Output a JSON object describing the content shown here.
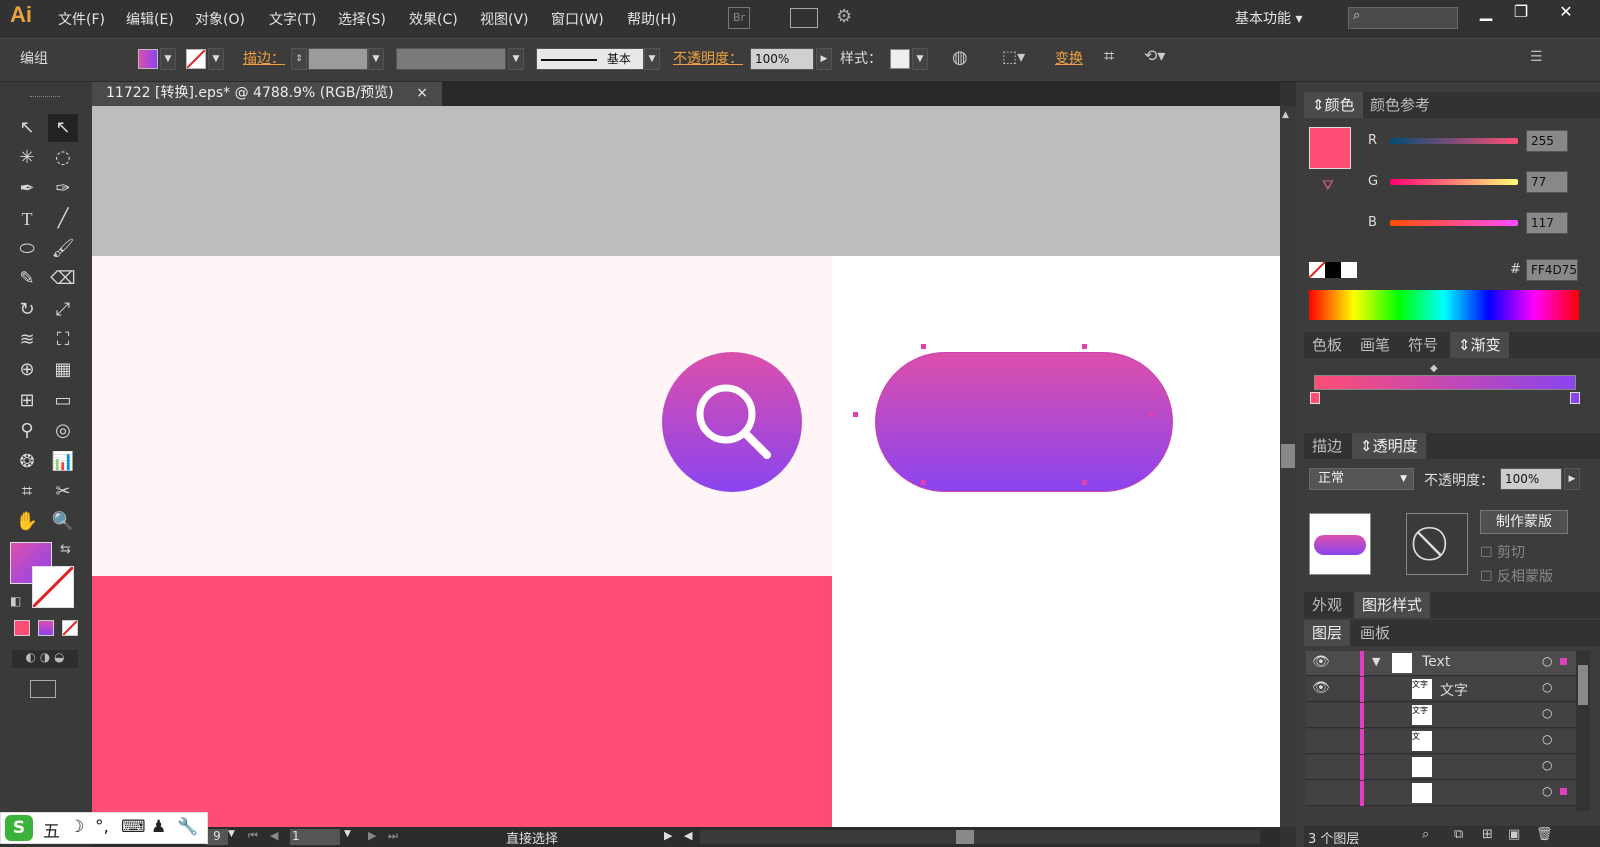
{
  "app": {
    "logo": "Ai"
  },
  "menu": [
    "文件(F)",
    "编辑(E)",
    "对象(O)",
    "文字(T)",
    "选择(S)",
    "效果(C)",
    "视图(V)",
    "窗口(W)",
    "帮助(H)"
  ],
  "bridge_label": "Br",
  "workspace": "基本功能",
  "control": {
    "selection_label": "编组",
    "stroke_label": "描边：",
    "stroke_style": "基本",
    "opacity_label": "不透明度：",
    "opacity_value": "100%",
    "style_label": "样式：",
    "transform_label": "变换"
  },
  "document_tab": {
    "title": "11722 [转换].eps* @ 4788.9% (RGB/预览)",
    "close": "×"
  },
  "colors": {
    "fill_start": "#dc4fab",
    "fill_end": "#8a44ef",
    "red_block": "#ff4d75",
    "swatch": "#ff4d75"
  },
  "color_panel": {
    "tabs": [
      "颜色",
      "颜色参考"
    ],
    "r_label": "R",
    "r_value": "255",
    "g_label": "G",
    "g_value": "77",
    "b_label": "B",
    "b_value": "117",
    "hex_label": "#",
    "hex_value": "FF4D75"
  },
  "swatch_tabs": [
    "色板",
    "画笔",
    "符号",
    "渐变"
  ],
  "transparency": {
    "tabs": [
      "描边",
      "透明度"
    ],
    "blend_mode": "正常",
    "opacity_label": "不透明度：",
    "opacity_value": "100%",
    "make_mask": "制作蒙版",
    "clip": "剪切",
    "invert_mask": "反相蒙版"
  },
  "appearance_tabs": [
    "外观",
    "图形样式"
  ],
  "layers_tabs": [
    "图层",
    "画板"
  ],
  "layers": [
    {
      "name": "Text",
      "thumb": ""
    },
    {
      "name": "文字",
      "thumb": "文字"
    },
    {
      "name": "",
      "thumb": "文字"
    },
    {
      "name": "",
      "thumb": "文"
    },
    {
      "name": "",
      "thumb": ""
    },
    {
      "name": "",
      "thumb": ""
    },
    {
      "name": "",
      "thumb": ""
    }
  ],
  "layers_footer": "3 个图层",
  "status": {
    "zoom": "9",
    "page": "1",
    "tool": "直接选择"
  },
  "ime": {
    "mode": "五"
  }
}
